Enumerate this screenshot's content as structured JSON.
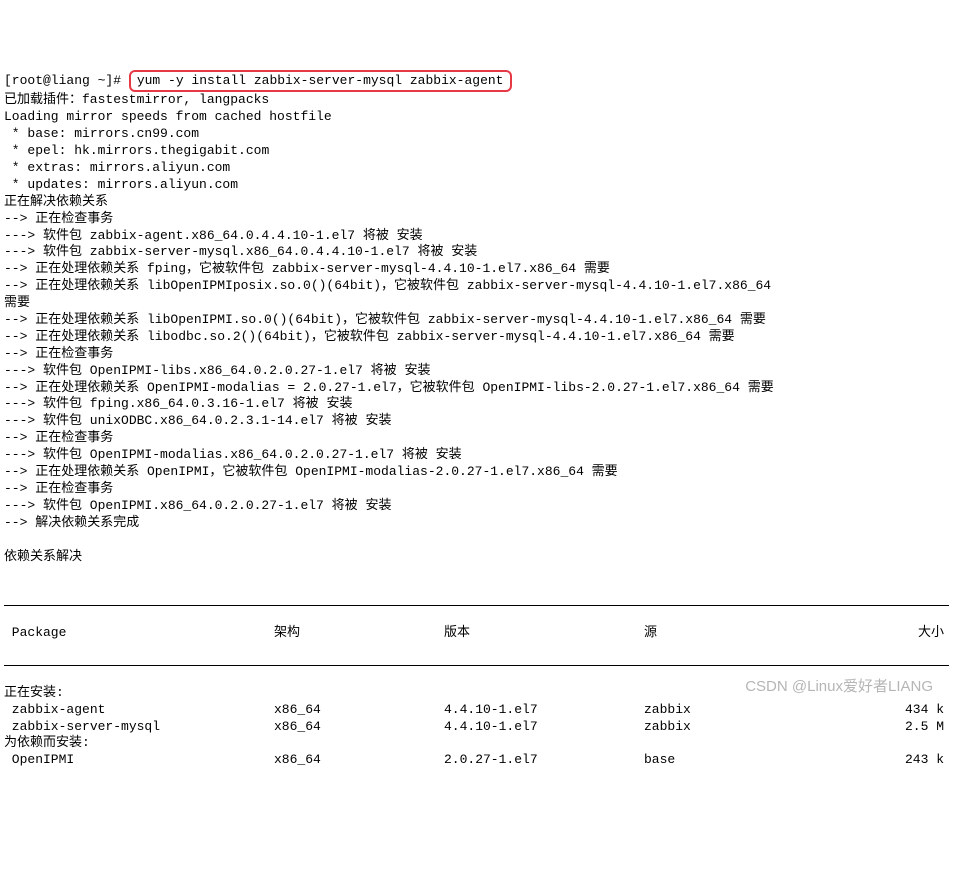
{
  "prompt": {
    "user_host": "[root@liang ~]# ",
    "command": "yum -y install zabbix-server-mysql zabbix-agent"
  },
  "output_lines": [
    "已加载插件：fastestmirror, langpacks",
    "Loading mirror speeds from cached hostfile",
    " * base: mirrors.cn99.com",
    " * epel: hk.mirrors.thegigabit.com",
    " * extras: mirrors.aliyun.com",
    " * updates: mirrors.aliyun.com",
    "正在解决依赖关系",
    "--> 正在检查事务",
    "---> 软件包 zabbix-agent.x86_64.0.4.4.10-1.el7 将被 安装",
    "---> 软件包 zabbix-server-mysql.x86_64.0.4.4.10-1.el7 将被 安装",
    "--> 正在处理依赖关系 fping，它被软件包 zabbix-server-mysql-4.4.10-1.el7.x86_64 需要",
    "--> 正在处理依赖关系 libOpenIPMIposix.so.0()(64bit)，它被软件包 zabbix-server-mysql-4.4.10-1.el7.x86_64 ",
    "需要",
    "--> 正在处理依赖关系 libOpenIPMI.so.0()(64bit)，它被软件包 zabbix-server-mysql-4.4.10-1.el7.x86_64 需要",
    "--> 正在处理依赖关系 libodbc.so.2()(64bit)，它被软件包 zabbix-server-mysql-4.4.10-1.el7.x86_64 需要",
    "--> 正在检查事务",
    "---> 软件包 OpenIPMI-libs.x86_64.0.2.0.27-1.el7 将被 安装",
    "--> 正在处理依赖关系 OpenIPMI-modalias = 2.0.27-1.el7，它被软件包 OpenIPMI-libs-2.0.27-1.el7.x86_64 需要",
    "---> 软件包 fping.x86_64.0.3.16-1.el7 将被 安装",
    "---> 软件包 unixODBC.x86_64.0.2.3.1-14.el7 将被 安装",
    "--> 正在检查事务",
    "---> 软件包 OpenIPMI-modalias.x86_64.0.2.0.27-1.el7 将被 安装",
    "--> 正在处理依赖关系 OpenIPMI，它被软件包 OpenIPMI-modalias-2.0.27-1.el7.x86_64 需要",
    "--> 正在检查事务",
    "---> 软件包 OpenIPMI.x86_64.0.2.0.27-1.el7 将被 安装",
    "--> 解决依赖关系完成",
    "",
    "依赖关系解决",
    ""
  ],
  "table": {
    "headers": {
      "package": " Package",
      "arch": "架构",
      "version": "版本",
      "source": "源",
      "size": "大小"
    },
    "sections": [
      {
        "title": "正在安装:",
        "rows": [
          {
            "pkg": " zabbix-agent",
            "arch": "x86_64",
            "ver": "4.4.10-1.el7",
            "src": "zabbix",
            "size": "434 k"
          },
          {
            "pkg": " zabbix-server-mysql",
            "arch": "x86_64",
            "ver": "4.4.10-1.el7",
            "src": "zabbix",
            "size": "2.5 M"
          }
        ]
      },
      {
        "title": "为依赖而安装:",
        "rows": [
          {
            "pkg": " OpenIPMI",
            "arch": "x86_64",
            "ver": "2.0.27-1.el7",
            "src": "base",
            "size": "243 k"
          }
        ]
      }
    ]
  },
  "watermark": "CSDN @Linux爱好者LIANG"
}
